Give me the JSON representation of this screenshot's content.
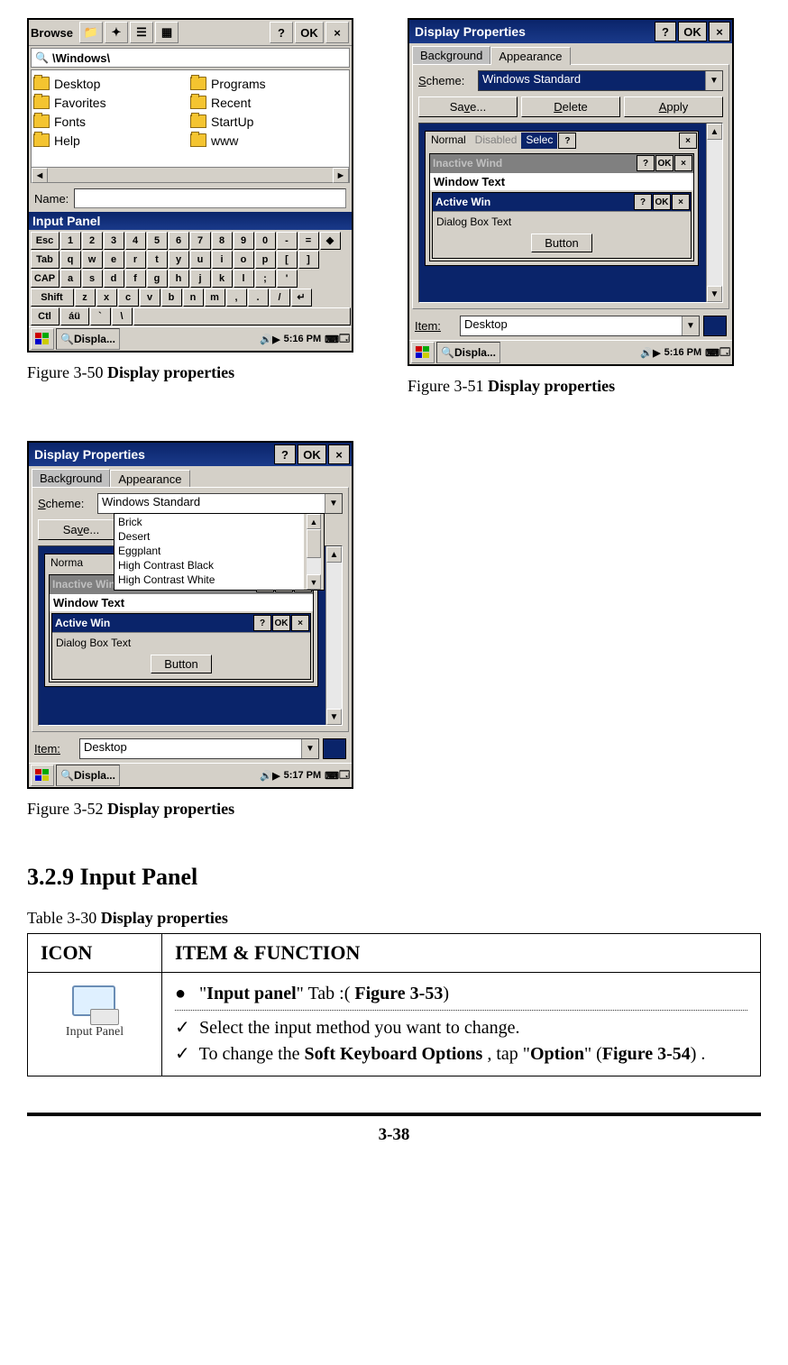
{
  "fig50": {
    "caption_prefix": "Figure 3-50 ",
    "caption_bold": "Display properties",
    "browse_title": "Browse",
    "ok": "OK",
    "close": "×",
    "help": "?",
    "path": "\\Windows\\",
    "folders_left": [
      "Desktop",
      "Favorites",
      "Fonts",
      "Help"
    ],
    "folders_right": [
      "Programs",
      "Recent",
      "StartUp",
      "www"
    ],
    "name_label": "Name:",
    "input_panel_title": "Input Panel",
    "kbd_rows": [
      [
        "Esc",
        "1",
        "2",
        "3",
        "4",
        "5",
        "6",
        "7",
        "8",
        "9",
        "0",
        "-",
        "=",
        "◆"
      ],
      [
        "Tab",
        "q",
        "w",
        "e",
        "r",
        "t",
        "y",
        "u",
        "i",
        "o",
        "p",
        "[",
        "]"
      ],
      [
        "CAP",
        "a",
        "s",
        "d",
        "f",
        "g",
        "h",
        "j",
        "k",
        "l",
        ";",
        "'"
      ],
      [
        "Shift",
        "z",
        "x",
        "c",
        "v",
        "b",
        "n",
        "m",
        ",",
        ".",
        "/",
        "↵"
      ],
      [
        "Ctl",
        "áü",
        "`",
        "\\",
        " "
      ]
    ],
    "task_label": "Displa...",
    "clock": "5:16 PM"
  },
  "fig51": {
    "caption_prefix": "Figure 3-51 ",
    "caption_bold": "Display properties",
    "title": "Display Properties",
    "tab_bg": "Background",
    "tab_ap": "Appearance",
    "scheme_label": "Scheme:",
    "scheme_value": "Windows Standard",
    "save": "Save...",
    "delete": "Delete",
    "apply": "Apply",
    "menu_normal": "Normal",
    "menu_disabled": "Disabled",
    "menu_selected": "Selec",
    "inactive_title": "Inactive Wind",
    "window_text": "Window Text",
    "active_title": "Active Win",
    "dialog_text": "Dialog Box Text",
    "button_label": "Button",
    "item_label": "Item:",
    "item_value": "Desktop",
    "ok": "OK",
    "help": "?",
    "close": "×",
    "task_label": "Displa...",
    "clock": "5:16 PM"
  },
  "fig52": {
    "caption_prefix": "Figure 3-52 ",
    "caption_bold": "Display properties",
    "title": "Display Properties",
    "tab_bg": "Background",
    "tab_ap": "Appearance",
    "scheme_label": "Scheme:",
    "scheme_value": "Windows Standard",
    "save": "Save...",
    "list": [
      "Brick",
      "Desert",
      "Eggplant",
      "High Contrast Black",
      "High Contrast White"
    ],
    "menu_normal": "Norma",
    "inactive_title": "Inactive Wind",
    "window_text": "Window Text",
    "active_title": "Active Win",
    "dialog_text": "Dialog Box Text",
    "button_label": "Button",
    "item_label": "Item:",
    "item_value": "Desktop",
    "ok": "OK",
    "help": "?",
    "close": "×",
    "task_label": "Displa...",
    "clock": "5:17 PM"
  },
  "section": {
    "heading": "3.2.9 Input Panel",
    "table_caption_prefix": "Table 3-30 ",
    "table_caption_bold": "Display properties",
    "th_icon": "ICON",
    "th_func": "ITEM & FUNCTION",
    "icon_label": "Input Panel",
    "bullet_text_pre": "\"",
    "bullet_text_b1": "Input panel",
    "bullet_text_mid": "\" Tab :( ",
    "bullet_text_b2": "Figure 3-53",
    "bullet_text_post": ")",
    "check1": "Select the input method you want to change.",
    "check2_pre": "To change the ",
    "check2_b1": "Soft Keyboard Options",
    "check2_mid": " , tap \"",
    "check2_b2": "Option",
    "check2_mid2": "\" (",
    "check2_b3": "Figure 3-54",
    "check2_post": ") ."
  },
  "footer": {
    "page": "3-38"
  }
}
